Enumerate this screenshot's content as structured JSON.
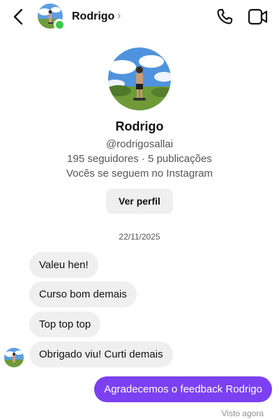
{
  "colors": {
    "accent_purple": "#7b40f2",
    "online_green": "#3cc84a",
    "bubble_in": "#efefef",
    "text_secondary": "#555555"
  },
  "header": {
    "back_icon": "chevron-left-icon",
    "name": "Rodrigo",
    "chevron": "›",
    "call_icon": "phone-icon",
    "video_icon": "video-camera-icon"
  },
  "profile": {
    "name": "Rodrigo",
    "handle": "@rodrigosallai",
    "stats": "195 seguidores · 5 publicações",
    "mutual": "Vocês se seguem no Instagram",
    "view_button": "Ver perfil"
  },
  "conversation": {
    "date": "22/11/2025",
    "messages": [
      {
        "from": "them",
        "text": "Valeu hen!"
      },
      {
        "from": "them",
        "text": "Curso bom demais"
      },
      {
        "from": "them",
        "text": "Top top top"
      },
      {
        "from": "them",
        "text": "Obrigado viu! Curti demais"
      },
      {
        "from": "me",
        "text": "Agradecemos o feedback Rodrigo"
      }
    ],
    "seen": "Visto agora"
  }
}
